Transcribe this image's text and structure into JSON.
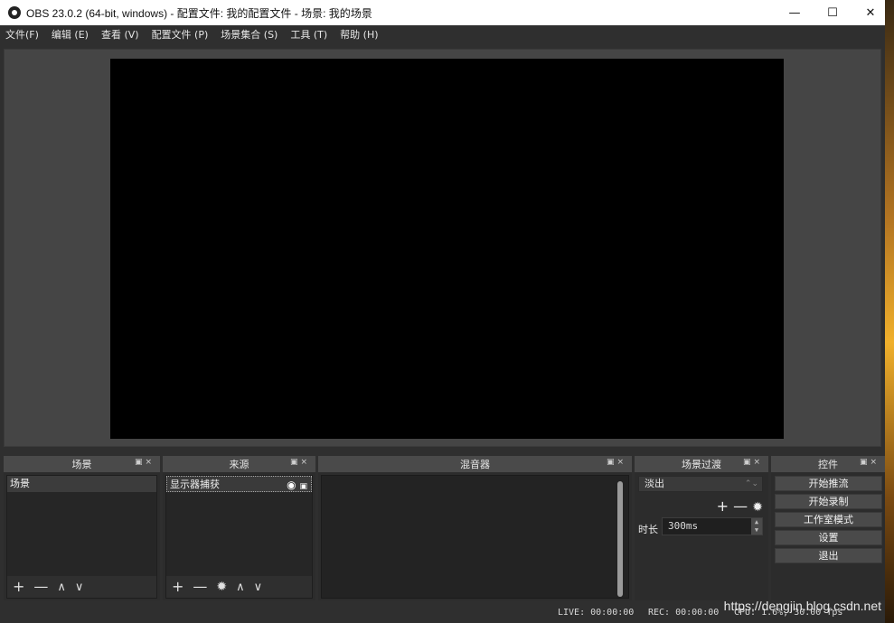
{
  "window": {
    "title": "OBS 23.0.2 (64-bit, windows) - 配置文件: 我的配置文件 - 场景: 我的场景",
    "controls": {
      "minimize": "—",
      "maximize": "☐",
      "close": "✕"
    }
  },
  "menu": [
    "文件(F)",
    "编辑 (E)",
    "查看 (V)",
    "配置文件 (P)",
    "场景集合 (S)",
    "工具 (T)",
    "帮助 (H)"
  ],
  "docks": {
    "scenes": {
      "title": "场景",
      "items": [
        "场景"
      ]
    },
    "sources": {
      "title": "来源",
      "items": [
        "显示器捕获"
      ]
    },
    "mixer": {
      "title": "混音器"
    },
    "transitions": {
      "title": "场景过渡",
      "selected": "淡出",
      "duration_label": "时长",
      "duration_value": "300ms"
    },
    "controls": {
      "title": "控件",
      "buttons": [
        "开始推流",
        "开始录制",
        "工作室模式",
        "设置",
        "退出"
      ]
    }
  },
  "status": {
    "live": "LIVE: 00:00:00",
    "rec": "REC: 00:00:00",
    "cpu": "CPU: 1.6%, 30.00 fps"
  },
  "watermark": "https://dengjin.blog.csdn.net",
  "icons": {
    "add": "+",
    "remove": "—",
    "up": "∧",
    "down": "∨",
    "gear": "✹",
    "eye": "👁",
    "lock": "🔒",
    "float": "▣",
    "close": "×"
  }
}
